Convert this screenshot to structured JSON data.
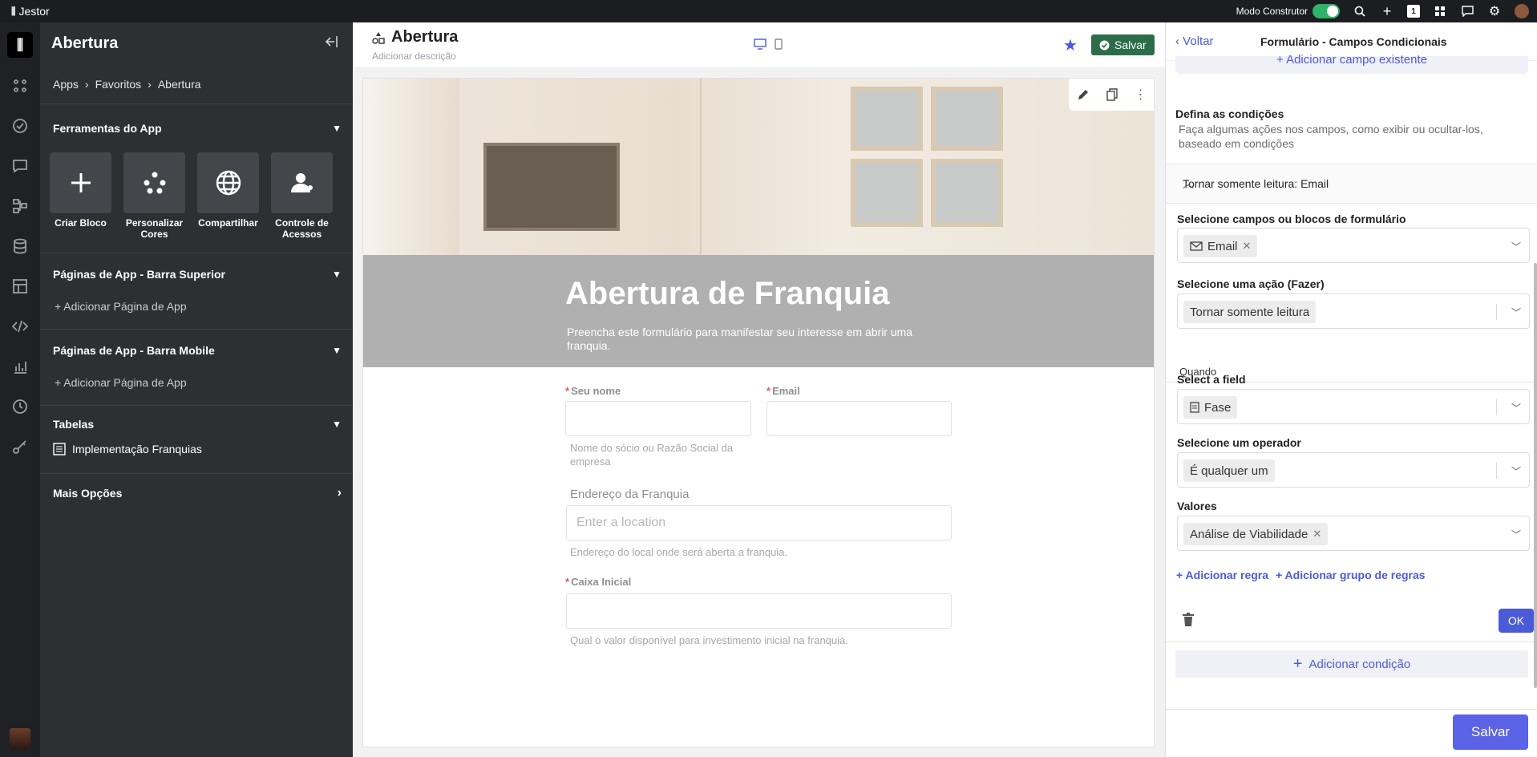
{
  "topbar": {
    "brand": "Jestor",
    "mode_label": "Modo Construtor",
    "notif_count": "1"
  },
  "sidebar": {
    "title": "Abertura",
    "breadcrumb": [
      "Apps",
      "Favoritos",
      "Abertura"
    ],
    "sections": {
      "tools": {
        "title": "Ferramentas do App",
        "items": [
          {
            "label": "Criar Bloco",
            "icon": "plus-icon"
          },
          {
            "label": "Personalizar Cores",
            "icon": "palette-icon"
          },
          {
            "label": "Compartilhar",
            "icon": "globe-icon"
          },
          {
            "label": "Controle de Acessos",
            "icon": "user-icon"
          }
        ]
      },
      "top_pages": {
        "title": "Páginas de App - Barra Superior",
        "add": "+ Adicionar Página de App"
      },
      "mobile_pages": {
        "title": "Páginas de App - Barra Mobile",
        "add": "+ Adicionar Página de App"
      },
      "tables": {
        "title": "Tabelas",
        "item": "Implementação Franquias"
      },
      "more": {
        "title": "Mais Opções"
      }
    }
  },
  "canvas": {
    "title": "Abertura",
    "description": "Adicionar descrição",
    "save": "Salvar",
    "form": {
      "heading": "Abertura de Franquia",
      "subheading": "Preencha este formulário para manifestar seu interesse em abrir uma franquia.",
      "fields": {
        "name_label": "Seu nome",
        "name_hint": "Nome do sócio ou Razão Social da empresa",
        "email_label": "Email",
        "address_label": "Endereço da Franquia",
        "address_placeholder": "Enter a location",
        "address_hint": "Endereço do local onde será aberta a franquia.",
        "cash_label": "Caixa Inicial",
        "cash_hint": "Qual o valor disponível para investimento inicial na franquia."
      }
    }
  },
  "panel": {
    "back": "Voltar",
    "title": "Formulário - Campos Condicionais",
    "add_existing": "Adicionar campo existente",
    "define_title": "Defina as condições",
    "define_sub": "Faça algumas ações nos campos, como exibir ou ocultar-los, baseado em condições",
    "rule_title": "Tornar somente leitura: Email",
    "select_fields_label": "Selecione campos ou blocos de formulário",
    "select_fields_value": "Email",
    "action_label": "Selecione uma ação (Fazer)",
    "action_value": "Tornar somente leitura",
    "when": "Quando",
    "field_label": "Select a field",
    "field_value": "Fase",
    "operator_label": "Selecione um operador",
    "operator_value": "É qualquer um",
    "values_label": "Valores",
    "values_value": "Análise de Viabilidade",
    "add_rule": "+ Adicionar regra",
    "add_rule_group": "+ Adicionar grupo de regras",
    "ok": "OK",
    "add_condition": "Adicionar condição",
    "save": "Salvar"
  }
}
